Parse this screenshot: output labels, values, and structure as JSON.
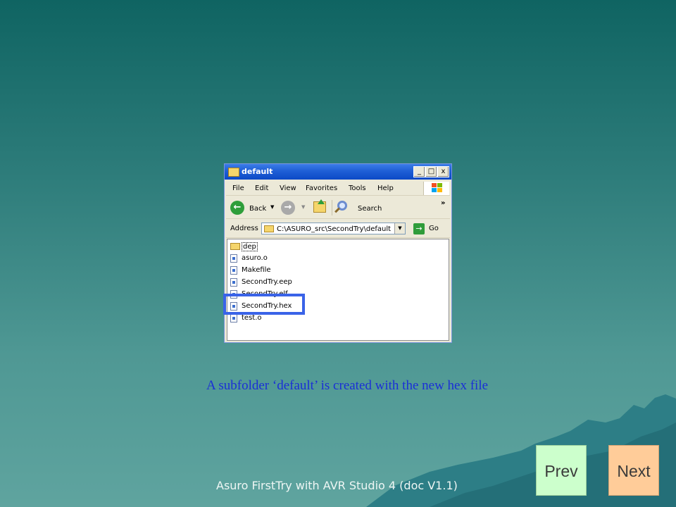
{
  "window": {
    "title": "default",
    "controls": {
      "minimize": "_",
      "maximize": "□",
      "close": "x"
    },
    "menu": [
      "File",
      "Edit",
      "View",
      "Favorites",
      "Tools",
      "Help"
    ],
    "toolbar": {
      "back": "Back",
      "search": "Search",
      "more": "»"
    },
    "address": {
      "label": "Address",
      "value": "C:\\ASURO_src\\SecondTry\\default",
      "go": "Go"
    },
    "files": [
      "dep",
      "asuro.o",
      "Makefile",
      "SecondTry.eep",
      "SecondTry.elf",
      "SecondTry.hex",
      "test.o"
    ]
  },
  "caption": "A subfolder ‘default’ is created with the new hex file",
  "footer": "Asuro FirstTry with AVR Studio 4 (doc V1.1)",
  "nav": {
    "prev": "Prev",
    "next": "Next"
  },
  "colors": {
    "highlight": "#3a63e8",
    "caption": "#1a2fd6",
    "prev_bg": "#ccffcc",
    "next_bg": "#ffcc99"
  }
}
